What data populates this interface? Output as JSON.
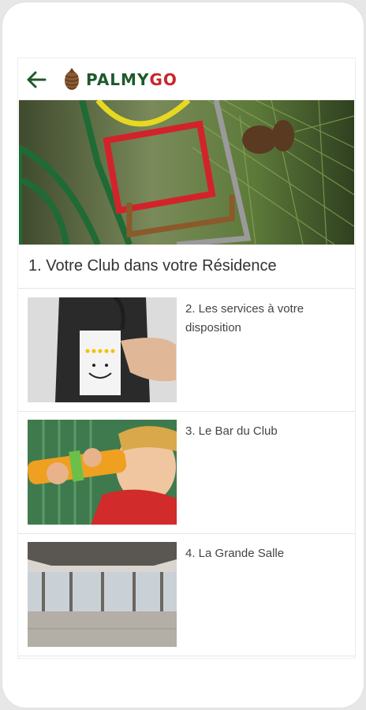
{
  "app": {
    "logo_part1": "PALMY",
    "logo_part2": "GO"
  },
  "header": {
    "back_icon": "arrow-left-icon",
    "logo_icon": "pinecone-icon"
  },
  "main": {
    "section_title": "1. Votre Club dans votre Résidence",
    "items": [
      {
        "label": "2. Les services à votre disposition"
      },
      {
        "label": "3. Le Bar du Club"
      },
      {
        "label": "4. La Grande Salle"
      }
    ]
  },
  "colors": {
    "brand_green": "#1d5a2c",
    "brand_red": "#c8262a"
  }
}
